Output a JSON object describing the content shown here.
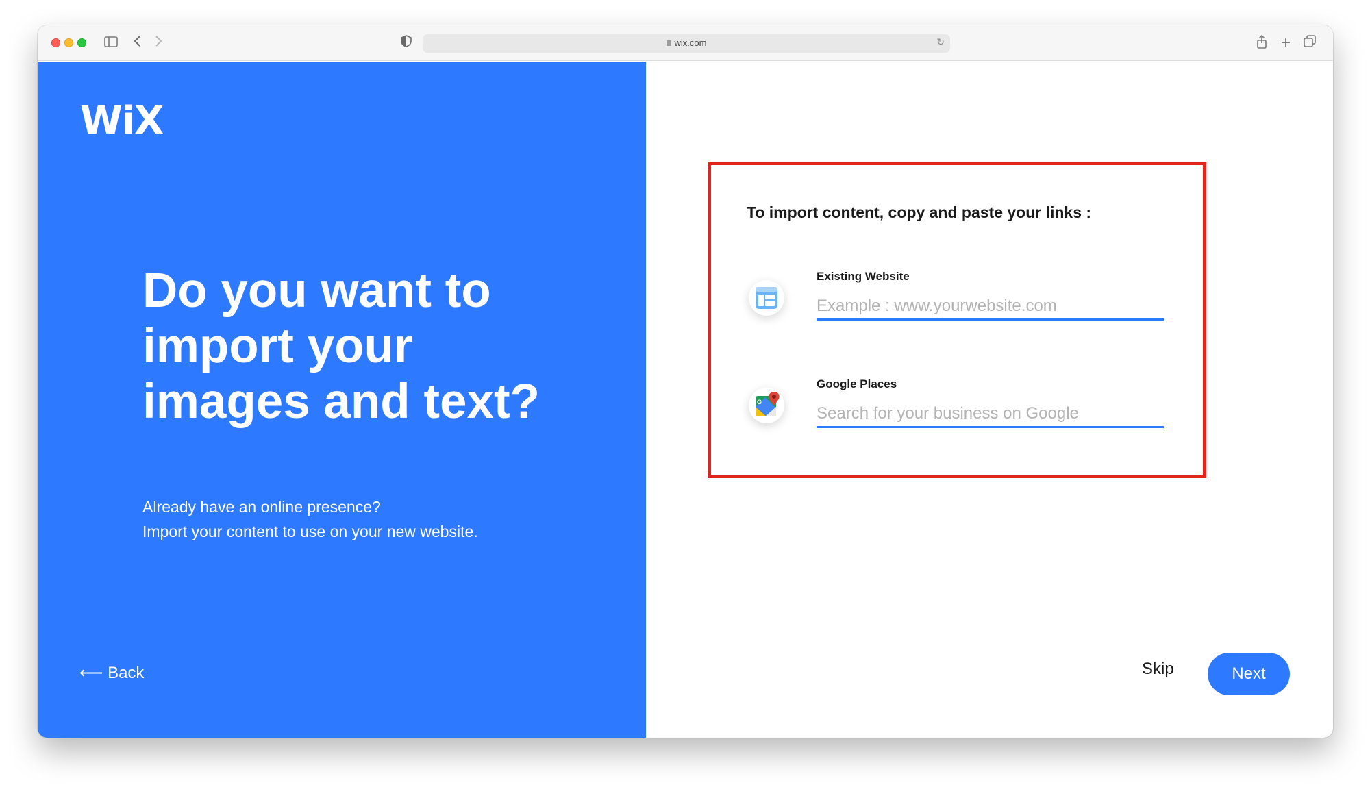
{
  "browser": {
    "url": "wix.com"
  },
  "brand": {
    "logo_text": "WiX",
    "accent_color": "#2d79ff"
  },
  "hero": {
    "headline": "Do you want to import your images and text?",
    "subtext_line1": "Already have an online presence?",
    "subtext_line2": "Import your content to use on your new website.",
    "back_label": "⟵ Back"
  },
  "import": {
    "title": "To import content, copy and paste your links :",
    "existing_website": {
      "label": "Existing Website",
      "placeholder": "Example : www.yourwebsite.com",
      "value": ""
    },
    "google_places": {
      "label": "Google Places",
      "placeholder": "Search for your business on Google",
      "value": ""
    },
    "highlight_color": "#e0261c"
  },
  "actions": {
    "skip_label": "Skip",
    "next_label": "Next"
  }
}
